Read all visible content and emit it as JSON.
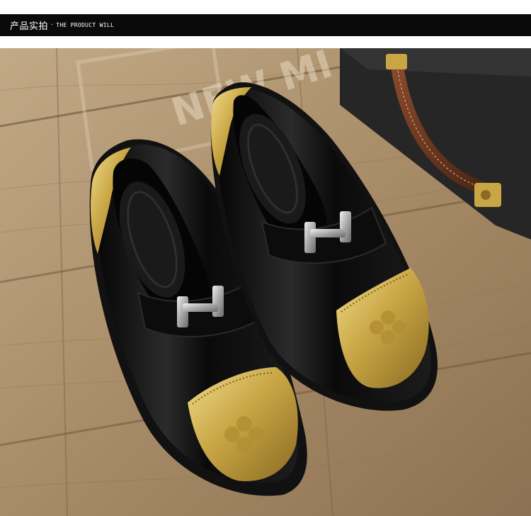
{
  "header": {
    "title_cn": "产品实拍",
    "separator": "·",
    "title_en": "THE PRODUCT WILL"
  },
  "photo": {
    "subject": "pair of black patent leather loafers with gold brogue toe caps and silver metal buckles",
    "background_text": "NEW MI",
    "colors": {
      "wood_light": "#b9a07c",
      "wood_dark": "#7a5f43",
      "patent_black": "#0d0d0d",
      "gold": "#c9a645",
      "silver": "#c8c8c8",
      "case_black": "#2a2a2a",
      "handle_brown": "#6b3a22"
    }
  }
}
